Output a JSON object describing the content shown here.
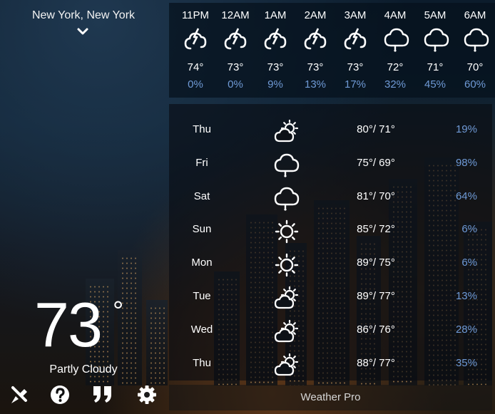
{
  "location": {
    "name": "New York, New York",
    "chevron_icon": "chevron-down-icon"
  },
  "current": {
    "temp": "73",
    "deg": "°",
    "condition": "Partly Cloudy"
  },
  "toolbar": [
    {
      "name": "satellite-icon"
    },
    {
      "name": "help-icon"
    },
    {
      "name": "quote-icon"
    },
    {
      "name": "settings-icon"
    }
  ],
  "hourly": [
    {
      "time": "11PM",
      "icon": "cloud-lightning-icon",
      "temp": "74°",
      "precip": "0%"
    },
    {
      "time": "12AM",
      "icon": "cloud-lightning-icon",
      "temp": "73°",
      "precip": "0%"
    },
    {
      "time": "1AM",
      "icon": "cloud-lightning-icon",
      "temp": "73°",
      "precip": "9%"
    },
    {
      "time": "2AM",
      "icon": "cloud-lightning-icon",
      "temp": "73°",
      "precip": "13%"
    },
    {
      "time": "3AM",
      "icon": "cloud-lightning-icon",
      "temp": "73°",
      "precip": "17%"
    },
    {
      "time": "4AM",
      "icon": "cloud-rain-icon",
      "temp": "72°",
      "precip": "32%"
    },
    {
      "time": "5AM",
      "icon": "cloud-rain-icon",
      "temp": "71°",
      "precip": "45%"
    },
    {
      "time": "6AM",
      "icon": "cloud-rain-icon",
      "temp": "70°",
      "precip": "60%"
    }
  ],
  "daily": [
    {
      "day": "Thu",
      "icon": "partly-cloudy-icon",
      "hilo": "80°/ 71°",
      "precip": "19%"
    },
    {
      "day": "Fri",
      "icon": "cloud-rain-icon",
      "hilo": "75°/ 69°",
      "precip": "98%"
    },
    {
      "day": "Sat",
      "icon": "cloud-rain-icon",
      "hilo": "81°/ 70°",
      "precip": "64%"
    },
    {
      "day": "Sun",
      "icon": "sun-icon",
      "hilo": "85°/ 72°",
      "precip": "6%"
    },
    {
      "day": "Mon",
      "icon": "sun-icon",
      "hilo": "89°/ 75°",
      "precip": "6%"
    },
    {
      "day": "Tue",
      "icon": "partly-cloudy-icon",
      "hilo": "89°/ 77°",
      "precip": "13%"
    },
    {
      "day": "Wed",
      "icon": "partly-cloudy-icon",
      "hilo": "86°/ 76°",
      "precip": "28%"
    },
    {
      "day": "Thu",
      "icon": "partly-cloudy-icon",
      "hilo": "88°/ 77°",
      "precip": "35%"
    }
  ],
  "footer": {
    "label": "Weather Pro"
  },
  "colors": {
    "precip": "#6f9ad6",
    "text": "#ffffff"
  }
}
